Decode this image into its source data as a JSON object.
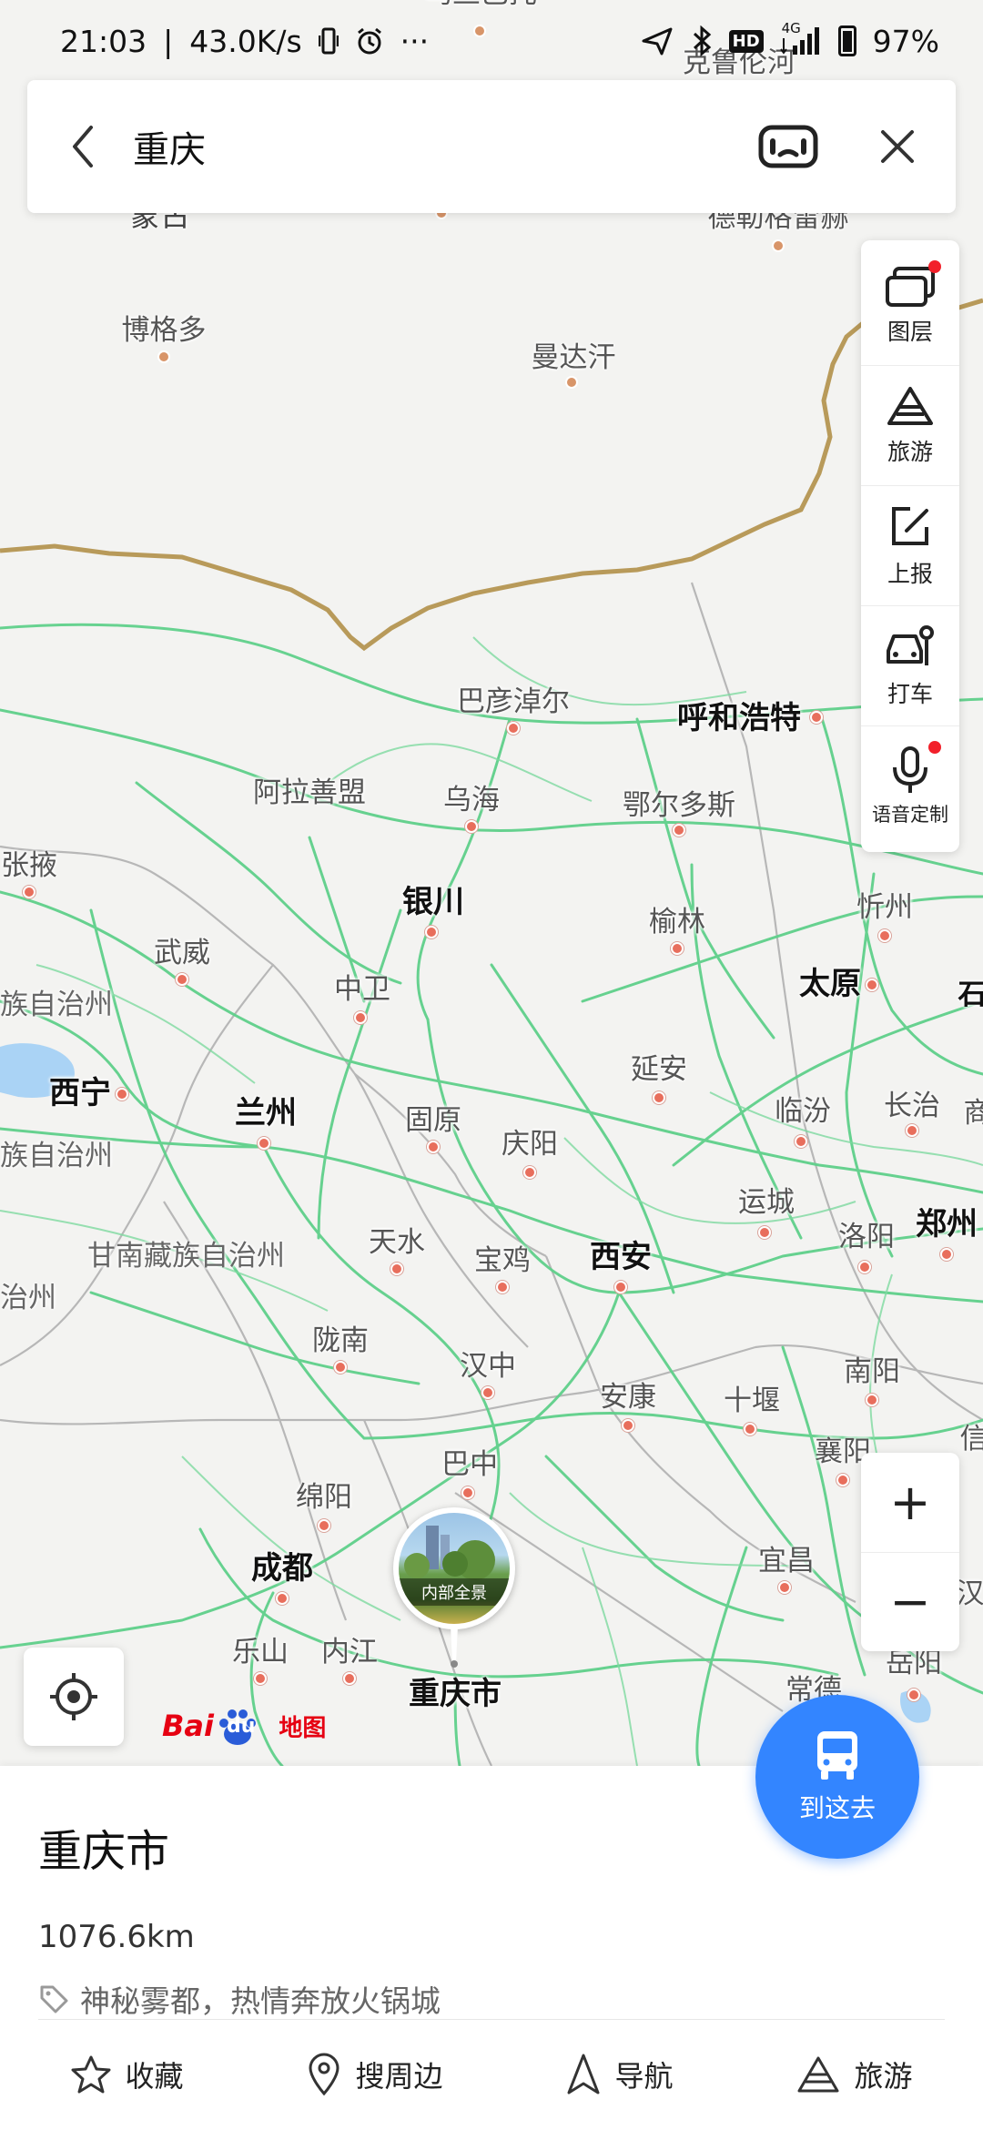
{
  "status_bar": {
    "time": "21:03",
    "net_speed": "43.0K/s",
    "more": "···",
    "network": "4G",
    "hd": "HD",
    "battery": "97%"
  },
  "search": {
    "query": "重庆",
    "icons": {
      "back": "chevron-left-icon",
      "ar": "ar-camera-icon",
      "close": "close-icon"
    }
  },
  "side_tools": [
    {
      "label": "图层",
      "icon": "layers-icon",
      "badge": true
    },
    {
      "label": "旅游",
      "icon": "travel-icon",
      "badge": false
    },
    {
      "label": "上报",
      "icon": "report-icon",
      "badge": false
    },
    {
      "label": "打车",
      "icon": "taxi-icon",
      "badge": false
    },
    {
      "label": "语音定制",
      "icon": "microphone-icon",
      "badge": true
    }
  ],
  "zoom": {
    "in": "+",
    "out": "−"
  },
  "map_labels": {
    "top_partial": "乌兰巴托",
    "top_right_partial": "克鲁伦河",
    "mengu": "蒙古",
    "degelunger": "德勒格雷赫",
    "bogeduo": "博格多",
    "mandahan": "曼达汗",
    "bayannaoer": "巴彦淖尔",
    "huhehaote": "呼和浩特",
    "alashan": "阿拉善盟",
    "wuhai": "乌海",
    "eerduosi": "鄂尔多斯",
    "zhangye": "张掖",
    "yinchuan": "银川",
    "yulin": "榆林",
    "xinzhou": "忻州",
    "wuwei": "武威",
    "zhongwei": "中卫",
    "taiyuan": "太原",
    "zizhi_1": "族自治州",
    "xining": "西宁",
    "lanzhou": "兰州",
    "guyuan": "固原",
    "yanan": "延安",
    "linfen": "临汾",
    "changzhi": "长治",
    "zizhi_2": "族自治州",
    "qingyang": "庆阳",
    "yuncheng": "运城",
    "zhengzhou": "郑州",
    "gannan": "甘南藏族自治州",
    "tianshui": "天水",
    "baoji": "宝鸡",
    "xian": "西安",
    "luoyang": "洛阳",
    "zhi_3": "治州",
    "longnan": "陇南",
    "hanzhong": "汉中",
    "ankang": "安康",
    "shiyan": "十堰",
    "nanyang": "南阳",
    "bazhong": "巴中",
    "mianyang": "绵阳",
    "xiangyang": "襄阳",
    "chengdu": "成都",
    "yichang": "宜昌",
    "leshan": "乐山",
    "neijiang": "内江",
    "chongqing": "重庆市",
    "yueyang": "岳阳",
    "changde": "常德",
    "edge_shi": "石",
    "edge_shang": "商",
    "edge_han": "汉",
    "edge_xin": "信"
  },
  "panorama": {
    "caption": "内部全景"
  },
  "logo": {
    "bai": "Bai",
    "du": "du",
    "map": "地图"
  },
  "go_button": {
    "label": "到这去",
    "icon": "bus-icon"
  },
  "place": {
    "name": "重庆市",
    "distance": "1076.6km",
    "tag": "神秘雾都，热情奔放火锅城",
    "actions": [
      {
        "label": "收藏",
        "icon": "star-icon"
      },
      {
        "label": "搜周边",
        "icon": "location-pin-icon"
      },
      {
        "label": "导航",
        "icon": "navigation-arrow-icon"
      },
      {
        "label": "旅游",
        "icon": "travel-icon"
      }
    ]
  },
  "colors": {
    "road": "#5fd08a",
    "border": "#b89a5a",
    "accent": "#3385ff",
    "city_dot": "#e86e5c",
    "badge": "#f2202a"
  }
}
